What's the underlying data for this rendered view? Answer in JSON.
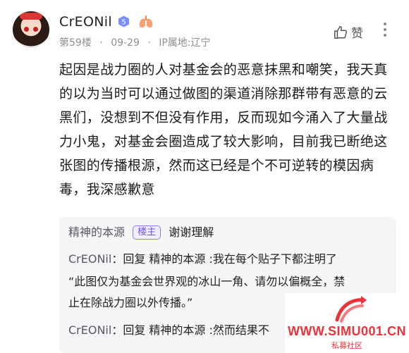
{
  "post": {
    "username": "CrEONil",
    "level": "5",
    "floor": "第59楼",
    "date": "09-29",
    "ip_location": "IP属地:辽宁",
    "like_label": "赞",
    "content": "起因是战力圈的人对基金会的恶意抹黑和嘲笑，我天真的以为当时可以通过做图的渠道消除那群带有恶意的云黑们，没想到不但没有作用，反而现如今涌入了大量战力小鬼，对基金会圈造成了较大影响，目前我已断绝这张图的传播根源，然而这已经是个不可逆转的模因病毒，我深感歉意"
  },
  "replies": [
    {
      "name": "精神的本源",
      "tag": "楼主",
      "text": "谢谢理解"
    },
    {
      "name": "CrEONil",
      "text": "回复 精神的本源 :我在每个贴子下都注明了"
    },
    {
      "text": "“此图仅为基金会世界观的冰山一角、请勿以偏概全，禁"
    },
    {
      "text": "止在除战力圈以外传播。”"
    },
    {
      "name": "CrEONil",
      "text": "回复 精神的本源 :然而结果不"
    }
  ],
  "watermark": {
    "site": "WWW.SIMU001.CN",
    "subtitle": "私募社区"
  },
  "colors": {
    "accent": "#6a5ae0",
    "badge": "#7a8cff",
    "watermark": "#e8333a"
  },
  "icons": [
    "level-5-badge",
    "lung-icon",
    "thumbs-up-icon",
    "more-vertical-icon"
  ]
}
